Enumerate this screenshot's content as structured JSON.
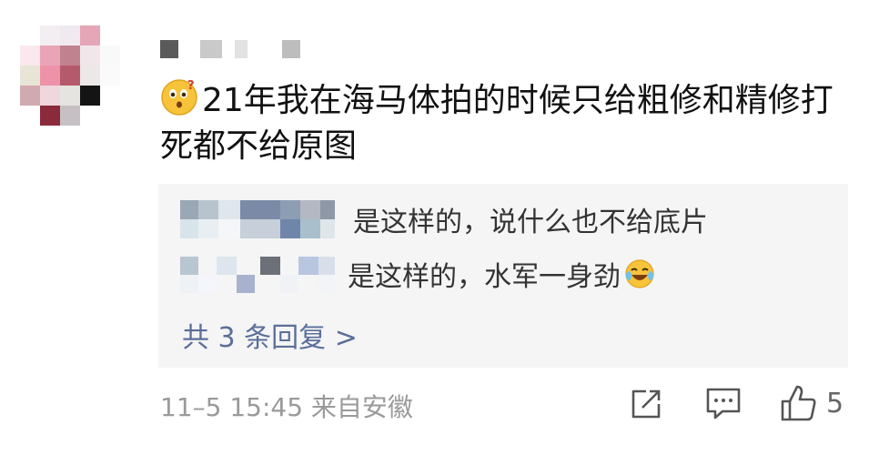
{
  "comment": {
    "main_text": "21年我在海马体拍的时候只给粗修和精修打死都不给原图",
    "emoji_icon": "wondering-face-icon",
    "meta": "11–5 15:45 来自安徽",
    "like_count": "5"
  },
  "replies": [
    {
      "text": "是这样的，说什么也不给底片"
    },
    {
      "text": "是这样的，水军一身劲",
      "emoji_icon": "laughing-tears-icon"
    }
  ],
  "more_replies_label": "共 3 条回复 >",
  "colors": {
    "reply_bg": "#f5f5f5",
    "link": "#5b6f9a",
    "meta": "#9a9a9a"
  },
  "avatar_cells": [
    "#ffffff",
    "#f3eef2",
    "#f0eaf0",
    "#e5a6b8",
    "#ffffff",
    "#fbe8ee",
    "#e9a5b7",
    "#c18290",
    "#f1e6ea",
    "#f9f9f9",
    "#e8e4d6",
    "#ed92a9",
    "#b55a6c",
    "#ece8e8",
    "#fafafa",
    "#d1a9b1",
    "#f0d7de",
    "#e6e4e0",
    "#141414",
    "#ffffff",
    "#ffffff",
    "#8b2a3b",
    "#c6c0c4",
    "#ffffff",
    "#ffffff"
  ]
}
